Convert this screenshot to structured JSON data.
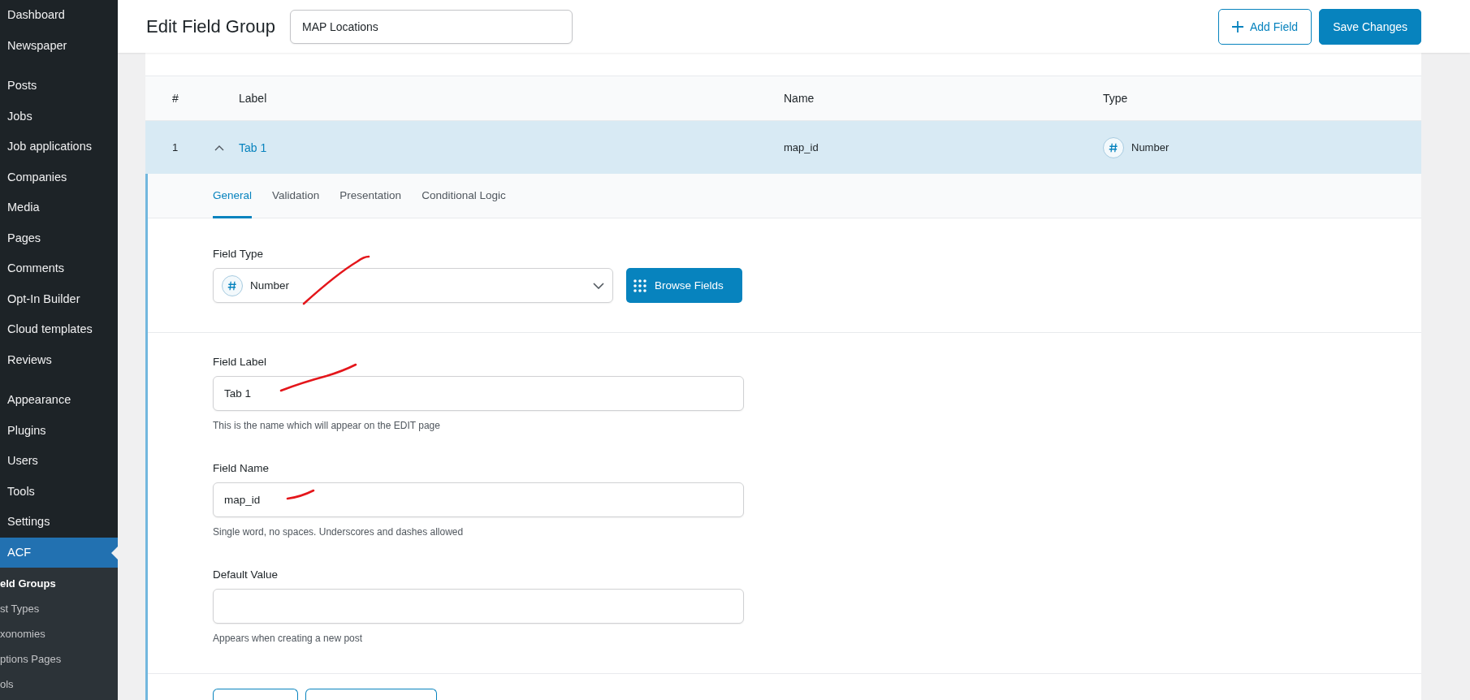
{
  "sidebar": {
    "menu_groups": [
      {
        "items": [
          {
            "label": "Dashboard",
            "selected": false
          },
          {
            "label": "Newspaper",
            "selected": false
          }
        ]
      },
      {
        "items": [
          {
            "label": "Posts",
            "selected": false
          },
          {
            "label": "Jobs",
            "selected": false
          },
          {
            "label": "Job applications",
            "selected": false
          },
          {
            "label": "Companies",
            "selected": false
          },
          {
            "label": "Media",
            "selected": false
          },
          {
            "label": "Pages",
            "selected": false
          },
          {
            "label": "Comments",
            "selected": false
          },
          {
            "label": "Opt-In Builder",
            "selected": false
          },
          {
            "label": "Cloud templates",
            "selected": false
          },
          {
            "label": "Reviews",
            "selected": false
          }
        ]
      },
      {
        "items": [
          {
            "label": "Appearance",
            "selected": false
          },
          {
            "label": "Plugins",
            "selected": false
          },
          {
            "label": "Users",
            "selected": false
          },
          {
            "label": "Tools",
            "selected": false
          },
          {
            "label": "Settings",
            "selected": false
          },
          {
            "label": "ACF",
            "selected": true
          }
        ]
      }
    ],
    "submenu": [
      {
        "label": "eld Groups",
        "selected": true
      },
      {
        "label": "st Types",
        "selected": false
      },
      {
        "label": "xonomies",
        "selected": false
      },
      {
        "label": "ptions Pages",
        "selected": false
      },
      {
        "label": "ols",
        "selected": false
      }
    ]
  },
  "header": {
    "title": "Edit Field Group",
    "group_title": "MAP Locations",
    "buttons": [
      {
        "label": "Add Field",
        "kind": "secondary"
      },
      {
        "label": "Save Changes",
        "kind": "primary"
      }
    ]
  },
  "table": {
    "columns": [
      "#",
      "Label",
      "Name",
      "Type"
    ],
    "rows": [
      {
        "number": "1",
        "label": "Tab 1",
        "name": "map_id",
        "type": "Number",
        "expanded": true
      }
    ]
  },
  "settings": {
    "tabs": [
      {
        "label": "General",
        "selected": true
      },
      {
        "label": "Validation",
        "selected": false
      },
      {
        "label": "Presentation",
        "selected": false
      },
      {
        "label": "Conditional Logic",
        "selected": false
      }
    ],
    "field_type": {
      "label": "Field Type",
      "value": "Number",
      "button": "Browse Fields",
      "annotated": true
    },
    "fields": [
      {
        "label": "Field Label",
        "value": "Tab 1",
        "hint": "This is the name which will appear on the EDIT page",
        "annotated": true
      },
      {
        "label": "Field Name",
        "value": "map_id",
        "hint": "Single word, no spaces. Underscores and dashes allowed",
        "annotated": true
      },
      {
        "label": "Default Value",
        "hint": "Appears when creating a new post"
      }
    ],
    "footer_buttons": [
      {
        "kind": "outline"
      },
      {
        "kind": "outline"
      }
    ]
  }
}
